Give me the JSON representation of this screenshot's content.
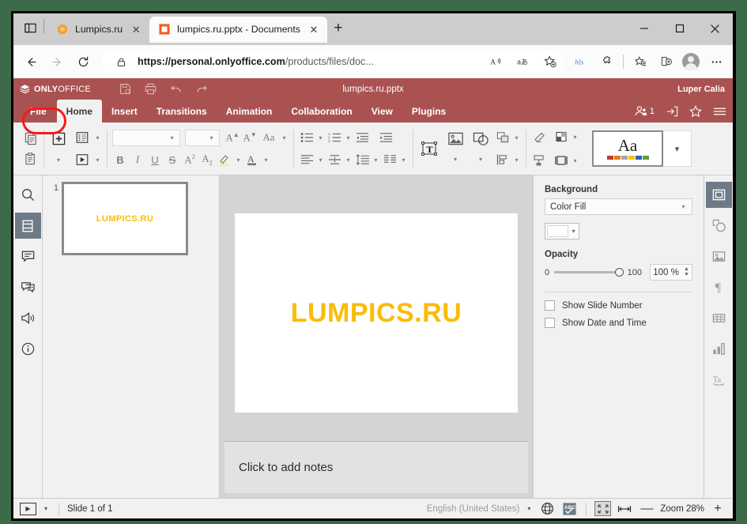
{
  "browser": {
    "tabs": [
      {
        "title": "Lumpics.ru",
        "favicon": "orange-circle-icon",
        "active": false
      },
      {
        "title": "lumpics.ru.pptx - Documents",
        "favicon": "onlyoffice-orange-square-icon",
        "active": true
      }
    ],
    "new_tab_label": "+",
    "window_controls": {
      "minimize": "—",
      "maximize": "□",
      "close": "✕"
    },
    "address": {
      "url_bold": "https://personal.onlyoffice.com",
      "url_rest": "/products/files/doc...",
      "full_url": "https://personal.onlyoffice.com/products/files/doc...",
      "lock_icon": "lock-icon",
      "read_aloud_icon": "read-aloud-icon",
      "translate_icon": "translate-icon",
      "favorite_icon": "add-favorite-icon"
    },
    "nav": {
      "back": "back-arrow-icon",
      "forward": "forward-arrow-icon",
      "refresh": "refresh-icon",
      "collections": "collections-icon",
      "extensions": "extensions-icon",
      "favorites": "favorites-list-icon",
      "split": "split-screen-icon",
      "profile": "profile-avatar-icon",
      "settings": "more-options-icon"
    }
  },
  "onlyoffice": {
    "brand_light": "ONLY",
    "brand_bold": "OFFICE",
    "document_title": "lumpics.ru.pptx",
    "user_name": "Luper Calia",
    "quick_access": [
      "save-icon",
      "print-icon",
      "undo-icon",
      "redo-icon"
    ],
    "tabs": [
      {
        "label": "File",
        "selected": false,
        "highlighted": true
      },
      {
        "label": "Home",
        "selected": true,
        "highlighted": false
      },
      {
        "label": "Insert",
        "selected": false,
        "highlighted": false
      },
      {
        "label": "Transitions",
        "selected": false,
        "highlighted": false
      },
      {
        "label": "Animation",
        "selected": false,
        "highlighted": false
      },
      {
        "label": "Collaboration",
        "selected": false,
        "highlighted": false
      },
      {
        "label": "View",
        "selected": false,
        "highlighted": false
      },
      {
        "label": "Plugins",
        "selected": false,
        "highlighted": false
      }
    ],
    "header_right": {
      "users_count": "1",
      "users_icon": "coauthor-users-icon",
      "share_icon": "share-icon",
      "favorite_icon": "star-icon",
      "menu_icon": "hamburger-menu-icon"
    },
    "colors": {
      "header": "#aa5252",
      "accent_text": "#fbbc05",
      "annotation": "#f91818",
      "sidebar_active": "#6e7a87"
    }
  },
  "ribbon": {
    "clipboard": [
      "copy-icon",
      "paste-icon"
    ],
    "slides": [
      "add-slide-icon",
      "slide-layout-icon",
      "slide-transition-icon"
    ],
    "font": {
      "family_value": "",
      "size_value": "",
      "increase_size": "A",
      "decrease_size": "A",
      "change_case": "Aa",
      "bold": "B",
      "italic": "I",
      "underline": "U",
      "strikethrough": "S",
      "superscript": "A",
      "subscript": "A",
      "highlight_icon": "highlight-color-icon",
      "font_color_icon": "font-color-icon"
    },
    "paragraph": [
      "bullet-list-icon",
      "numbered-list-icon",
      "decrease-indent-icon",
      "increase-indent-icon",
      "align-left-icon",
      "vertical-align-icon",
      "line-spacing-icon",
      "columns-icon"
    ],
    "insert": [
      "text-box-icon",
      "insert-image-icon",
      "insert-shape-icon"
    ],
    "arrange": [
      "arrange-shape-icon",
      "align-shape-icon"
    ],
    "styles": [
      "clear-style-icon",
      "shape-fill-icon",
      "shape-outline-icon",
      "select-all-icon"
    ],
    "theme": {
      "preview_label": "Aa",
      "swatch_colors": [
        "#c0392b",
        "#e07b1e",
        "#a6a6a6",
        "#f2c300",
        "#2f5fc0",
        "#5aa03c"
      ],
      "expand_icon": "chevron-down-icon"
    }
  },
  "left_sidebar": {
    "items": [
      {
        "icon": "search-icon",
        "name": "search",
        "active": false
      },
      {
        "icon": "slides-icon",
        "name": "slides",
        "active": true
      },
      {
        "icon": "comments-icon",
        "name": "comments",
        "active": false
      },
      {
        "icon": "chat-icon",
        "name": "chat",
        "active": false
      },
      {
        "icon": "feedback-icon",
        "name": "feedback",
        "active": false
      },
      {
        "icon": "about-icon",
        "name": "about",
        "active": false
      }
    ]
  },
  "right_sidebar": {
    "items": [
      {
        "icon": "slide-settings-icon",
        "name": "slide-settings",
        "active": true
      },
      {
        "icon": "shape-settings-icon",
        "name": "shape-settings",
        "active": false
      },
      {
        "icon": "image-settings-icon",
        "name": "image-settings",
        "active": false
      },
      {
        "icon": "paragraph-settings-icon",
        "name": "paragraph-settings",
        "active": false
      },
      {
        "icon": "table-settings-icon",
        "name": "table-settings",
        "active": false
      },
      {
        "icon": "chart-settings-icon",
        "name": "chart-settings",
        "active": false
      },
      {
        "icon": "text-art-settings-icon",
        "name": "text-art-settings",
        "active": false
      }
    ]
  },
  "slides": {
    "thumbnail_number": "1",
    "thumbnail_text": "LUMPICS.RU",
    "slide_text": "LUMPICS.RU",
    "notes_placeholder": "Click to add notes"
  },
  "right_panel": {
    "background_label": "Background",
    "fill_type": "Color Fill",
    "fill_color": "#ffffff",
    "opacity_label": "Opacity",
    "opacity_min": "0",
    "opacity_max": "100",
    "opacity_value": "100 %",
    "show_slide_number": "Show Slide Number",
    "show_date_and_time": "Show Date and Time"
  },
  "status_bar": {
    "start_slideshow_icon": "start-slideshow-icon",
    "slide_counter": "Slide 1 of 1",
    "language": "English (United States)",
    "language_globe_icon": "globe-icon",
    "spellcheck_icon": "spellcheck-abc-icon",
    "fit_slide_icon": "fit-to-slide-icon",
    "fit_width_icon": "fit-to-width-icon",
    "zoom_out": "—",
    "zoom_label": "Zoom 28%",
    "zoom_in": "+"
  }
}
